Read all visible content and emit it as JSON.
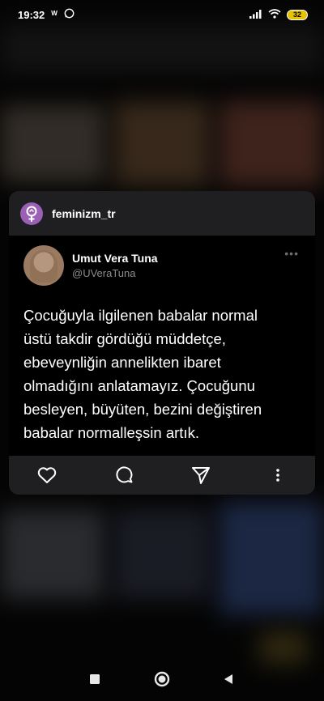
{
  "status_bar": {
    "time": "19:32",
    "battery": "32"
  },
  "card": {
    "account_name": "feminizm_tr",
    "tweet": {
      "display_name": "Umut Vera Tuna",
      "handle": "@UVeraTuna",
      "text": "Çocuğuyla ilgilenen babalar normal\nüstü takdir gördüğü müddetçe,\nebeveynliğin annelikten ibaret\nolmadığını anlatamayız. Çocuğunu\nbesleyen, büyüten, bezini değiştiren\nbabalar normalleşsin artık."
    },
    "actions": [
      "heart-icon",
      "comment-icon",
      "share-icon",
      "more-icon"
    ]
  },
  "nav": [
    "recents-square-icon",
    "home-circle-icon",
    "back-triangle-icon"
  ],
  "colors": {
    "card_bg": "#000000",
    "bar_bg": "#1f1f21",
    "handle": "#8a8d91",
    "avatar_purple": "#9b5fb5",
    "battery": "#e7c200"
  }
}
